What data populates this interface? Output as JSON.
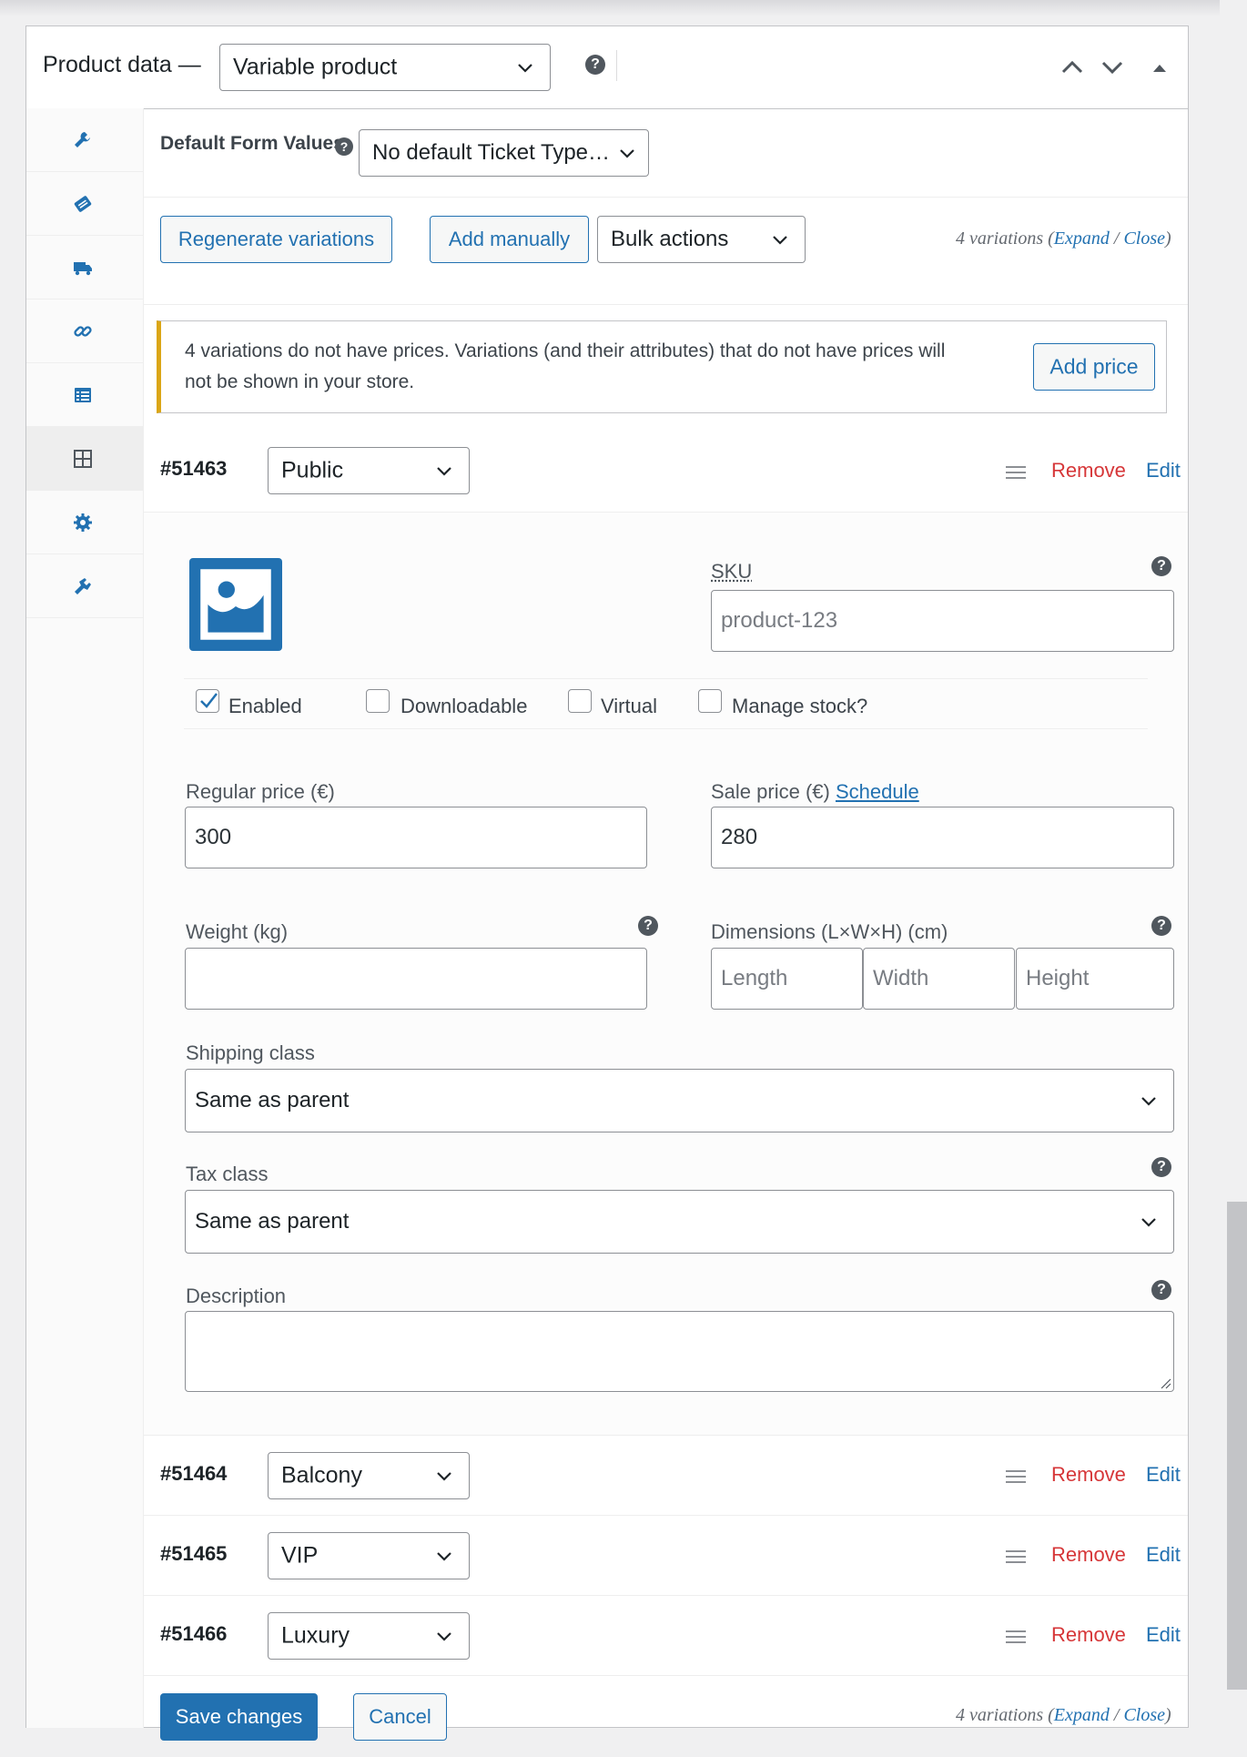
{
  "header": {
    "title": "Product data —",
    "product_type": "Variable product"
  },
  "tabs": [
    {
      "icon": "wrench-icon"
    },
    {
      "icon": "tag-icon"
    },
    {
      "icon": "truck-icon"
    },
    {
      "icon": "link-icon"
    },
    {
      "icon": "list-icon"
    },
    {
      "icon": "grid-icon"
    },
    {
      "icon": "gear-icon"
    },
    {
      "icon": "plugin-icon"
    }
  ],
  "defaults": {
    "label": "Default Form Values:",
    "ticket_type": "No default Ticket Type…"
  },
  "toolbar": {
    "regenerate": "Regenerate variations",
    "add_manually": "Add manually",
    "bulk_actions": "Bulk actions",
    "count": "4 variations (",
    "expand": "Expand",
    "slash": " / ",
    "close": "Close",
    "paren": ")"
  },
  "notice": {
    "message": "4 variations do not have prices. Variations (and their attributes) that do not have prices will not be shown in your store.",
    "button": "Add price"
  },
  "variations": [
    {
      "id": "#51463",
      "type": "Public",
      "remove": "Remove",
      "edit": "Edit"
    },
    {
      "id": "#51464",
      "type": "Balcony",
      "remove": "Remove",
      "edit": "Edit"
    },
    {
      "id": "#51465",
      "type": "VIP",
      "remove": "Remove",
      "edit": "Edit"
    },
    {
      "id": "#51466",
      "type": "Luxury",
      "remove": "Remove",
      "edit": "Edit"
    }
  ],
  "detail": {
    "sku_label": "SKU",
    "sku_value": "product-123",
    "enabled": "Enabled",
    "downloadable": "Downloadable",
    "virtual": "Virtual",
    "manage_stock": "Manage stock?",
    "regular_price_label": "Regular price (€)",
    "regular_price": "300",
    "sale_price_label": "Sale price (€)",
    "schedule": "Schedule",
    "sale_price": "280",
    "weight_label": "Weight (kg)",
    "dimensions_label": "Dimensions (L×W×H) (cm)",
    "length_ph": "Length",
    "width_ph": "Width",
    "height_ph": "Height",
    "shipping_label": "Shipping class",
    "shipping_value": "Same as parent",
    "tax_label": "Tax class",
    "tax_value": "Same as parent",
    "description_label": "Description"
  },
  "footer": {
    "save": "Save changes",
    "cancel": "Cancel"
  },
  "colors": {
    "primary": "#2271b1",
    "danger": "#d63638",
    "warning": "#dba617"
  }
}
